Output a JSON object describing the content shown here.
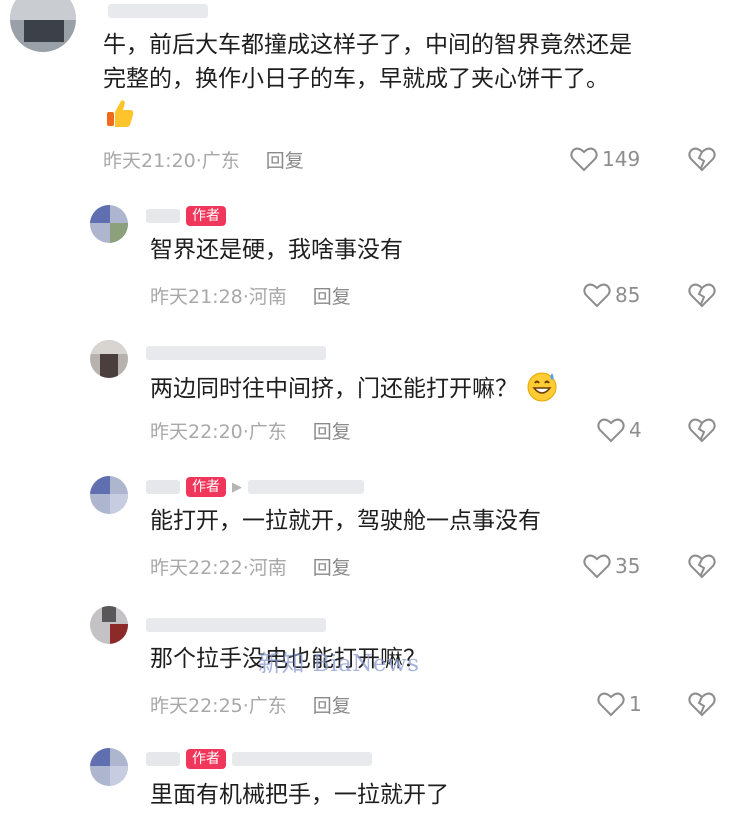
{
  "comments": [
    {
      "text_lines": [
        "牛，前后大车都撞成这样子了，中间的智界竟然还是",
        "完整的，换作小日子的车，早就成了夹心饼干了。"
      ],
      "time_location": "昨天21:20·广东",
      "reply_label": "回复",
      "likes": "149",
      "emoji": "thumbs-up-emoji"
    },
    {
      "badge": "作者",
      "text_lines": [
        "智界还是硬，我啥事没有"
      ],
      "time_location": "昨天21:28·河南",
      "reply_label": "回复",
      "likes": "85"
    },
    {
      "text_lines": [
        "两边同时往中间挤，门还能打开嘛？"
      ],
      "time_location": "昨天22:20·广东",
      "reply_label": "回复",
      "likes": "4",
      "emoji": "sweat-smile-emoji"
    },
    {
      "badge": "作者",
      "reply_arrow": "▶",
      "text_lines": [
        "能打开，一拉就开，驾驶舱一点事没有"
      ],
      "time_location": "昨天22:22·河南",
      "reply_label": "回复",
      "likes": "35"
    },
    {
      "text_lines": [
        "那个拉手没电也能打开嘛？"
      ],
      "time_location": "昨天22:25·广东",
      "reply_label": "回复",
      "likes": "1"
    },
    {
      "badge": "作者",
      "text_lines": [
        "里面有机械把手，一拉就开了"
      ]
    }
  ],
  "watermark": "新知 BiaNews",
  "colors": {
    "badge": "#f0365a",
    "meta": "#a8a8a8",
    "icon": "#8d8d8d"
  },
  "icons": {
    "like": "heart-outline-icon",
    "dislike": "broken-heart-outline-icon"
  }
}
